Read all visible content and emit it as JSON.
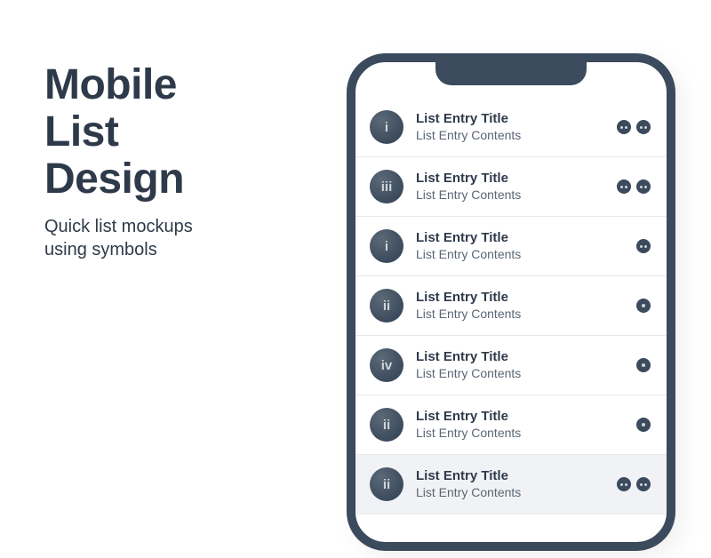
{
  "header": {
    "title_line1": "Mobile",
    "title_line2": "List",
    "title_line3": "Design",
    "subtitle_line1": "Quick list mockups",
    "subtitle_line2": "using symbols"
  },
  "colors": {
    "frame": "#3b4a5c",
    "text_primary": "#2e3a4a"
  },
  "list": {
    "rows": [
      {
        "badge": "i",
        "title": "List Entry Title",
        "subtitle": "List Entry Contents",
        "actions": [
          "double",
          "double"
        ],
        "selected": false
      },
      {
        "badge": "iii",
        "title": "List Entry Title",
        "subtitle": "List Entry Contents",
        "actions": [
          "double",
          "double"
        ],
        "selected": false
      },
      {
        "badge": "i",
        "title": "List Entry Title",
        "subtitle": "List Entry Contents",
        "actions": [
          "double"
        ],
        "selected": false
      },
      {
        "badge": "ii",
        "title": "List Entry Title",
        "subtitle": "List Entry Contents",
        "actions": [
          "single"
        ],
        "selected": false
      },
      {
        "badge": "iv",
        "title": "List Entry Title",
        "subtitle": "List Entry Contents",
        "actions": [
          "single"
        ],
        "selected": false
      },
      {
        "badge": "ii",
        "title": "List Entry Title",
        "subtitle": "List Entry Contents",
        "actions": [
          "single"
        ],
        "selected": false
      },
      {
        "badge": "ii",
        "title": "List Entry Title",
        "subtitle": "List Entry Contents",
        "actions": [
          "double",
          "double"
        ],
        "selected": true
      }
    ]
  }
}
